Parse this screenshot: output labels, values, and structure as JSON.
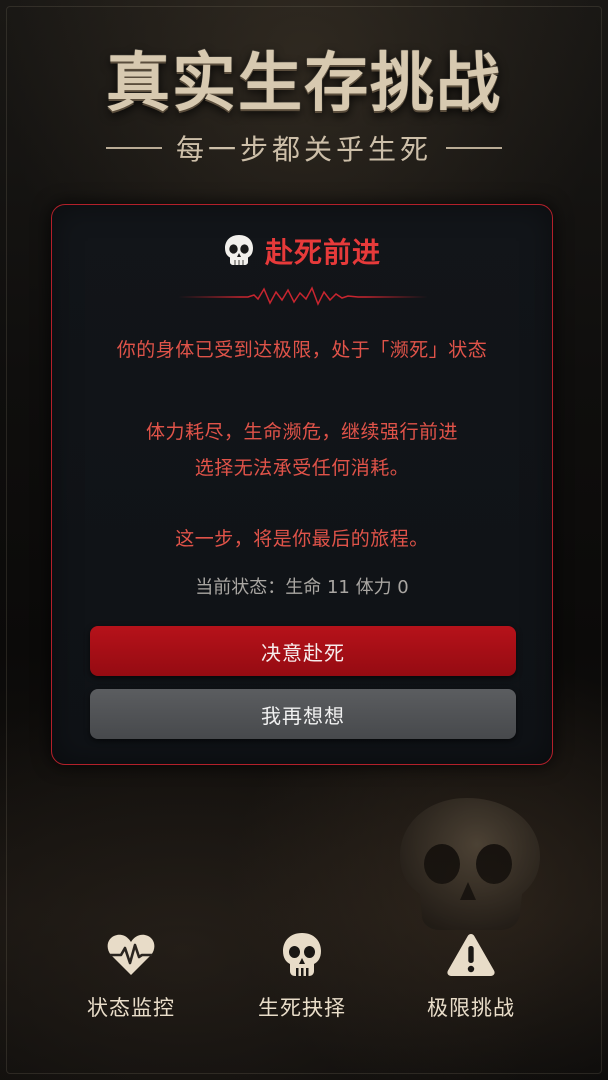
{
  "header": {
    "title": "真实生存挑战",
    "subtitle": "每一步都关乎生死"
  },
  "dialog": {
    "icon": "skull-icon",
    "title": "赴死前进",
    "lines": [
      "你的身体已受到达极限，处于「濒死」状态",
      "体力耗尽，生命濒危，继续强行前进",
      "选择无法承受任何消耗。",
      "这一步，将是你最后的旅程。"
    ],
    "status": "当前状态：生命 11 体力 0",
    "confirm_label": "决意赴死",
    "cancel_label": "我再想想"
  },
  "nav": {
    "items": [
      {
        "icon": "heartbeat-icon",
        "label": "状态监控"
      },
      {
        "icon": "skull-icon",
        "label": "生死抉择"
      },
      {
        "icon": "warning-icon",
        "label": "极限挑战"
      }
    ]
  },
  "colors": {
    "accent_red": "#e63a3a",
    "button_red": "#b6121a",
    "button_gray": "#55575a",
    "gold_text": "#d7c9b0"
  }
}
